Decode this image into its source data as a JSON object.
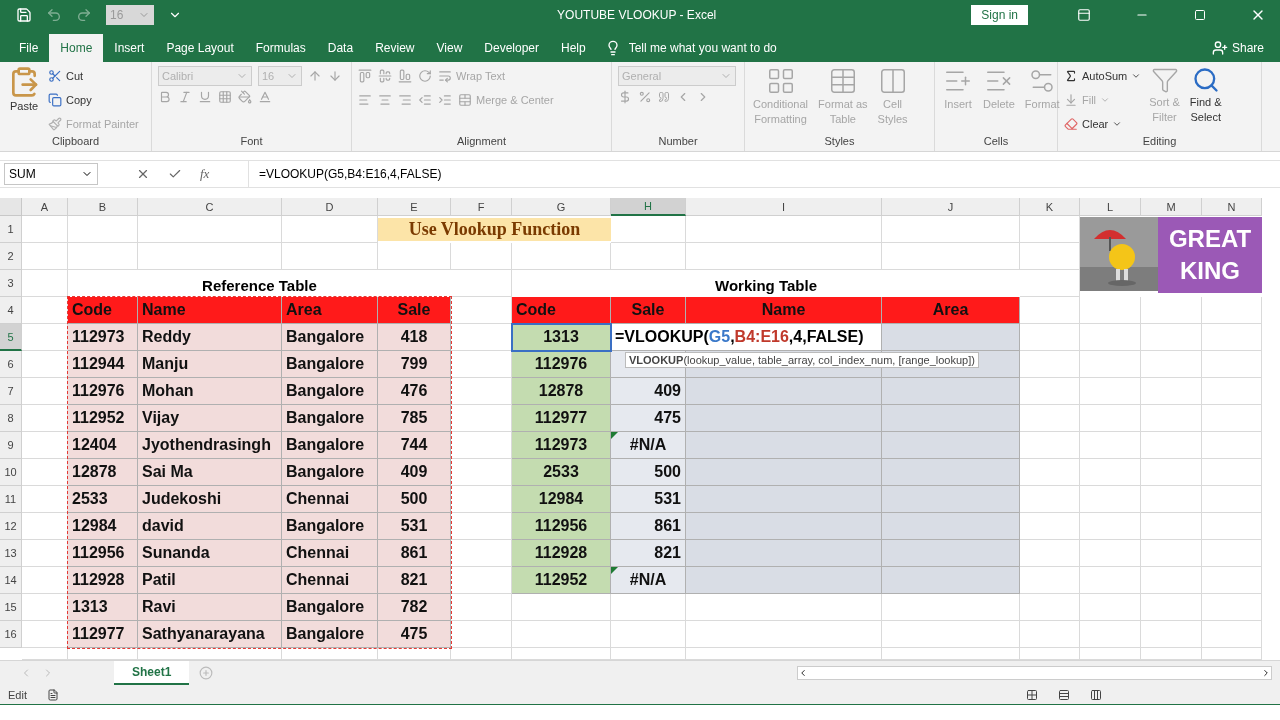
{
  "title_bar": {
    "font_size": "16",
    "title": "YOUTUBE VLOOKUP  -  Excel",
    "sign_in": "Sign in"
  },
  "menu_tabs": [
    {
      "label": "File",
      "selected": false
    },
    {
      "label": "Home",
      "selected": true
    },
    {
      "label": "Insert",
      "selected": false
    },
    {
      "label": "Page Layout",
      "selected": false
    },
    {
      "label": "Formulas",
      "selected": false
    },
    {
      "label": "Data",
      "selected": false
    },
    {
      "label": "Review",
      "selected": false
    },
    {
      "label": "View",
      "selected": false
    },
    {
      "label": "Developer",
      "selected": false
    },
    {
      "label": "Help",
      "selected": false
    }
  ],
  "tell_me": "Tell me what you want to do",
  "share": "Share",
  "ribbon": [
    {
      "kind": "clipboard",
      "label": "Clipboard",
      "items": [
        {
          "lines": [
            "Paste"
          ],
          "disabled": false
        },
        {
          "lines": [
            "Cut"
          ],
          "disabled": false
        },
        {
          "lines": [
            "Copy"
          ],
          "disabled": false
        },
        {
          "lines": [
            "Format Painter"
          ],
          "disabled": true
        }
      ]
    },
    {
      "kind": "font",
      "label": "Font",
      "fields": [
        {
          "value": "Calibri",
          "disabled": true
        },
        {
          "value": "16",
          "disabled": true
        }
      ]
    },
    {
      "kind": "alignment",
      "label": "Alignment",
      "items": [
        {
          "lines": [
            "Wrap Text"
          ],
          "disabled": true
        },
        {
          "lines": [
            "Merge & Center"
          ],
          "disabled": true
        }
      ]
    },
    {
      "kind": "number",
      "label": "Number",
      "fields": [
        {
          "value": "General",
          "disabled": true
        }
      ]
    },
    {
      "kind": "styles",
      "label": "Styles",
      "items": [
        {
          "lines": [
            "Conditional",
            "Formatting"
          ],
          "disabled": true
        },
        {
          "lines": [
            "Format as",
            "Table"
          ],
          "disabled": true
        },
        {
          "lines": [
            "Cell",
            "Styles"
          ],
          "disabled": true
        }
      ]
    },
    {
      "kind": "cells",
      "label": "Cells",
      "items": [
        {
          "lines": [
            "Insert"
          ],
          "disabled": true
        },
        {
          "lines": [
            "Delete"
          ],
          "disabled": true
        },
        {
          "lines": [
            "Format"
          ],
          "disabled": true
        }
      ]
    },
    {
      "kind": "editing",
      "label": "Editing",
      "items": [
        {
          "lines": [
            "AutoSum"
          ],
          "disabled": false
        },
        {
          "lines": [
            "Fill"
          ],
          "disabled": true
        },
        {
          "lines": [
            "Clear"
          ],
          "disabled": false
        },
        {
          "lines": [
            "Sort &",
            "Filter"
          ],
          "disabled": true
        },
        {
          "lines": [
            "Find &",
            "Select"
          ],
          "disabled": false
        }
      ]
    }
  ],
  "formula_bar": {
    "name_box": "SUM",
    "fx": "fx",
    "formula": "=VLOOKUP(G5,B4:E16,4,FALSE)"
  },
  "columns": [
    {
      "label": "A",
      "selected": false
    },
    {
      "label": "B",
      "selected": false
    },
    {
      "label": "C",
      "selected": false
    },
    {
      "label": "D",
      "selected": false
    },
    {
      "label": "E",
      "selected": false
    },
    {
      "label": "F",
      "selected": false
    },
    {
      "label": "G",
      "selected": false
    },
    {
      "label": "H",
      "selected": true
    },
    {
      "label": "I",
      "selected": false
    },
    {
      "label": "J",
      "selected": false
    },
    {
      "label": "K",
      "selected": false
    },
    {
      "label": "L",
      "selected": false
    },
    {
      "label": "M",
      "selected": false
    },
    {
      "label": "N",
      "selected": false
    }
  ],
  "rows": [
    {
      "label": "1",
      "selected": false
    },
    {
      "label": "2",
      "selected": false
    },
    {
      "label": "3",
      "selected": false
    },
    {
      "label": "4",
      "selected": false
    },
    {
      "label": "5",
      "selected": true
    },
    {
      "label": "6",
      "selected": false
    },
    {
      "label": "7",
      "selected": false
    },
    {
      "label": "8",
      "selected": false
    },
    {
      "label": "9",
      "selected": false
    },
    {
      "label": "10",
      "selected": false
    },
    {
      "label": "11",
      "selected": false
    },
    {
      "label": "12",
      "selected": false
    },
    {
      "label": "13",
      "selected": false
    },
    {
      "label": "14",
      "selected": false
    },
    {
      "label": "15",
      "selected": false
    },
    {
      "label": "16",
      "selected": false
    }
  ],
  "banner": "Use Vlookup Function",
  "logo": {
    "lines": [
      "GREAT",
      "KING"
    ]
  },
  "reference_table": {
    "title": "Reference Table",
    "columns": [
      "Code",
      "Name",
      "Area",
      "Sale"
    ],
    "rows": [
      [
        "112973",
        "Reddy",
        "Bangalore",
        "418"
      ],
      [
        "112944",
        "Manju",
        "Bangalore",
        "799"
      ],
      [
        "112976",
        "Mohan",
        "Bangalore",
        "476"
      ],
      [
        "112952",
        "Vijay",
        "Bangalore",
        "785"
      ],
      [
        "12404",
        "Jyothendrasingh",
        "Bangalore",
        "744"
      ],
      [
        "12878",
        "Sai Ma",
        "Bangalore",
        "409"
      ],
      [
        "2533",
        "Judekoshi",
        "Chennai",
        "500"
      ],
      [
        "12984",
        "david",
        "Bangalore",
        "531"
      ],
      [
        "112956",
        "Sunanda",
        "Chennai",
        "861"
      ],
      [
        "112928",
        "Patil",
        "Chennai",
        "821"
      ],
      [
        "1313",
        "Ravi",
        "Bangalore",
        "782"
      ],
      [
        "112977",
        "Sathyanarayana",
        "Bangalore",
        "475"
      ]
    ]
  },
  "working_table": {
    "title": "Working Table",
    "columns": [
      "Code",
      "Sale",
      "Name",
      "Area"
    ],
    "editing": {
      "parts": [
        {
          "text": "=VLOOKUP(",
          "color": "#000000"
        },
        {
          "text": "G5",
          "color": "#3a78c9"
        },
        {
          "text": ",",
          "color": "#000000"
        },
        {
          "text": "B4:E16",
          "color": "#c0392b"
        },
        {
          "text": ",4,FALSE)",
          "color": "#000000"
        }
      ]
    },
    "tooltip": "**VLOOKUP**(lookup_value, table_array, col_index_num, [range_lookup])",
    "rows": [
      {
        "code": "1313",
        "error": false
      },
      {
        "code": "112976",
        "error": false
      },
      {
        "code": "12878",
        "sale": "409",
        "error": false
      },
      {
        "code": "112977",
        "sale": "475",
        "error": false
      },
      {
        "code": "112973",
        "sale": "#N/A",
        "error": true
      },
      {
        "code": "2533",
        "sale": "500",
        "error": false
      },
      {
        "code": "12984",
        "sale": "531",
        "error": false
      },
      {
        "code": "112956",
        "sale": "861",
        "error": false
      },
      {
        "code": "112928",
        "sale": "821",
        "error": false
      },
      {
        "code": "112952",
        "sale": "#N/A",
        "error": true
      }
    ]
  },
  "sheet_tabs": [
    {
      "label": "Sheet1",
      "selected": true
    }
  ],
  "status": "Edit"
}
